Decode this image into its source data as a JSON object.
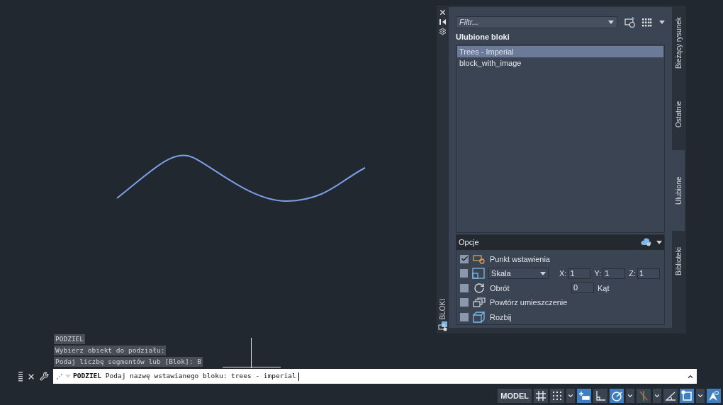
{
  "palette": {
    "title": "BLOKI",
    "filter": {
      "placeholder": "Filtr..."
    },
    "section_title": "Ulubione bloki",
    "blocks": [
      {
        "name": "Trees - Imperial",
        "selected": true
      },
      {
        "name": "block_with_image",
        "selected": false
      }
    ],
    "options": {
      "title": "Opcje",
      "rows": [
        {
          "kind": "check",
          "label": "Punkt wstawienia",
          "checked": true
        },
        {
          "kind": "scale",
          "checked": false,
          "select": "Skala",
          "fields": [
            {
              "label": "X:",
              "value": "1"
            },
            {
              "label": "Y:",
              "value": "1"
            },
            {
              "label": "Z:",
              "value": "1"
            }
          ]
        },
        {
          "kind": "angle",
          "label": "Obrót",
          "checked": false,
          "value": "0",
          "unit": "Kąt"
        },
        {
          "kind": "check",
          "label": "Powtórz umieszczenie",
          "checked": false
        },
        {
          "kind": "check",
          "label": "Rozbij",
          "checked": false
        }
      ]
    },
    "tabs": [
      {
        "label": "Bieżący rysunek",
        "selected": false
      },
      {
        "label": "Ostatnie",
        "selected": false
      },
      {
        "label": "Ulubione",
        "selected": true
      },
      {
        "label": "Biblioteki",
        "selected": false
      }
    ]
  },
  "history": [
    "PODZIEL",
    "Wybierz obiekt do podziału:",
    "Podaj liczbę segmentów lub [Blok]: B"
  ],
  "command": {
    "name": "PODZIEL",
    "prompt": "Podaj nazwę wstawianego bloku:",
    "value": "trees - imperial"
  },
  "status": {
    "model": "MODEL",
    "items": [
      {
        "kind": "toggle",
        "on": false
      },
      {
        "kind": "toggle",
        "on": false
      },
      {
        "kind": "dropdown"
      },
      {
        "kind": "toggle",
        "on": true
      },
      {
        "kind": "toggle",
        "on": false
      },
      {
        "kind": "toggle",
        "on": true
      },
      {
        "kind": "dropdown"
      },
      {
        "kind": "toggle",
        "on": false
      },
      {
        "kind": "dropdown"
      },
      {
        "kind": "toggle",
        "on": false
      },
      {
        "kind": "toggle",
        "on": true
      },
      {
        "kind": "dropdown"
      },
      {
        "kind": "toggle",
        "on": true
      }
    ]
  }
}
